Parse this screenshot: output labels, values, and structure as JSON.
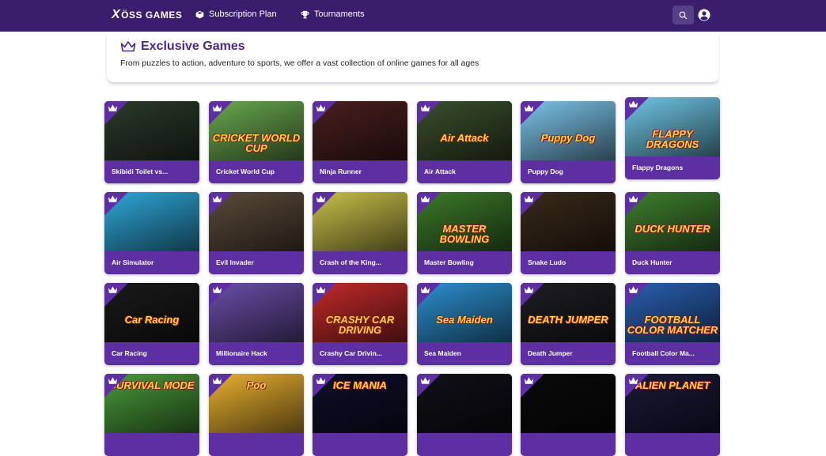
{
  "nav": {
    "logo_mark": "X",
    "logo_text": "ÖSS GAMES",
    "subscription": "Subscription Plan",
    "tournaments": "Tournaments"
  },
  "header": {
    "title": "Exclusive Games",
    "subtitle": "From puzzles to action, adventure to sports, we offer a vast collection of online games for all ages"
  },
  "games": [
    {
      "name": "Skibidi Toilet vs...",
      "thumb_text": "",
      "bg": "#2b3a2a"
    },
    {
      "name": "Cricket World Cup",
      "thumb_text": "CRICKET WORLD CUP",
      "bg": "#6aa84f"
    },
    {
      "name": "Ninja Runner",
      "thumb_text": "",
      "bg": "#4a1f1f"
    },
    {
      "name": "Air Attack",
      "thumb_text": "Air Attack",
      "bg": "#3a4f2b"
    },
    {
      "name": "Puppy Dog",
      "thumb_text": "Puppy Dog",
      "bg": "#7cc3e8"
    },
    {
      "name": "Flappy Dragons",
      "thumb_text": "FLAPPY DRAGONS",
      "bg": "#6fc6e6"
    },
    {
      "name": "Air Simulator",
      "thumb_text": "",
      "bg": "#2fa7d9"
    },
    {
      "name": "Evil Invader",
      "thumb_text": "",
      "bg": "#5b4a3a"
    },
    {
      "name": "Crash of the King...",
      "thumb_text": "",
      "bg": "#c9c04a"
    },
    {
      "name": "Master Bowling",
      "thumb_text": "MASTER BOWLING",
      "bg": "#3c7a2a"
    },
    {
      "name": "Snake Ludo",
      "thumb_text": "",
      "bg": "#3a2a1a"
    },
    {
      "name": "Duck Hunter",
      "thumb_text": "DUCK HUNTER",
      "bg": "#3f7f2f"
    },
    {
      "name": "Car Racing",
      "thumb_text": "Car Racing",
      "bg": "#1a1a1a"
    },
    {
      "name": "Millionaire Hack",
      "thumb_text": "",
      "bg": "#6a4fa8"
    },
    {
      "name": "Crashy Car Drivin...",
      "thumb_text": "CRASHY CAR DRIVING",
      "bg": "#c12a2a"
    },
    {
      "name": "Sea Maiden",
      "thumb_text": "Sea Maiden",
      "bg": "#2d8fd0"
    },
    {
      "name": "Death Jumper",
      "thumb_text": "DEATH JUMPER",
      "bg": "#1e1e24"
    },
    {
      "name": "Football Color Ma...",
      "thumb_text": "FOOTBALL COLOR MATCHER",
      "bg": "#2a5fb0"
    },
    {
      "name": "",
      "thumb_text": "SURVIVAL MODE",
      "bg": "#4a9a3a"
    },
    {
      "name": "",
      "thumb_text": "Poo",
      "bg": "#e8b030"
    },
    {
      "name": "",
      "thumb_text": "ICE MANIA",
      "bg": "#0f0f2a"
    },
    {
      "name": "",
      "thumb_text": "",
      "bg": "#101018"
    },
    {
      "name": "",
      "thumb_text": "",
      "bg": "#0a0a0a"
    },
    {
      "name": "",
      "thumb_text": "ALIEN PLANET",
      "bg": "#1a1a3a"
    }
  ],
  "colors": {
    "navbar": "#3b1d6e",
    "card": "#5d2fa3",
    "accent": "#4b2597"
  },
  "icons": [
    "cube-icon",
    "trophy-icon",
    "search-icon",
    "user-circle-icon",
    "crown-icon"
  ]
}
